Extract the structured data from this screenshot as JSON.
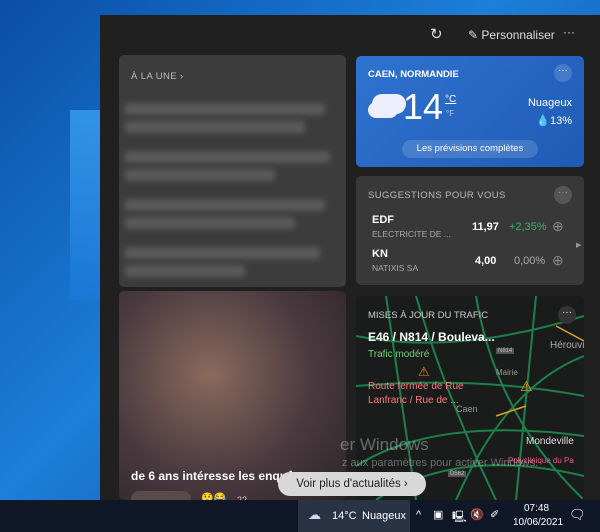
{
  "topbar": {
    "customize_label": "Personnaliser",
    "refresh_icon": "refresh-icon",
    "more_icon": "more-icon"
  },
  "news": {
    "header": "À LA UNE ›",
    "image_caption": "de 6 ans intéresse les enquê",
    "reaction_count": "22"
  },
  "weather": {
    "location": "CAEN, NORMANDIE",
    "temperature": "14",
    "unit_c": "°C",
    "unit_f": "°F",
    "condition": "Nuageux",
    "precipitation": "13%",
    "forecast_button": "Les prévisions complètes"
  },
  "suggestions": {
    "header": "SUGGESTIONS POUR VOUS",
    "stocks": [
      {
        "symbol": "EDF",
        "name": "ELECTRICITE DE ...",
        "price": "11,97",
        "change": "+2,35%",
        "positive": true
      },
      {
        "symbol": "KN",
        "name": "NATIXIS SA",
        "price": "4,00",
        "change": "0,00%",
        "positive": false
      }
    ]
  },
  "traffic": {
    "header": "MISES À JOUR DU TRAFIC",
    "road": "E46 / N814 / Bouleva...",
    "status": "Trafic modéré",
    "incident": "Route fermée de Rue Lanfranc / Rue de ...",
    "map_labels": [
      "Hérouville",
      "Mairie",
      "Caen",
      "Mondeville",
      "Polyclinique du Pa",
      "N814",
      "D562"
    ]
  },
  "watermark": {
    "line1": "er Windows",
    "line2": "z aux paramètres pour activer Windows."
  },
  "more_news_button": "Voir plus d'actualités",
  "taskbar": {
    "weather": "14°C",
    "condition": "Nuageux",
    "time": "07:48",
    "date": "10/06/2021"
  },
  "colors": {
    "accent": "#2f73d0",
    "positive": "#3cb371",
    "traffic_ok": "#6fcf6f",
    "incident": "#ff7a7a"
  }
}
